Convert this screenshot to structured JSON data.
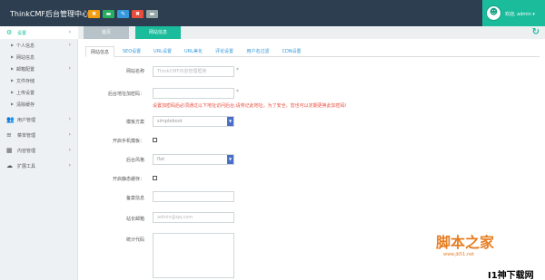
{
  "app": {
    "title": "ThinkCMF后台管理中心"
  },
  "quick_buttons": [
    "✖",
    "▬",
    "✎",
    "✖",
    "▬"
  ],
  "user": {
    "welcome": "欢迎, admin ▾",
    "avatar_glyph": "☻"
  },
  "sidebar": {
    "active_group": {
      "icon": "⚙",
      "label": "设置",
      "chevron": "‹"
    },
    "subitems": [
      {
        "label": "个人信息",
        "chevron": "›"
      },
      {
        "label": "网站信息"
      },
      {
        "label": "邮箱配置",
        "chevron": "›"
      },
      {
        "label": "文件存储"
      },
      {
        "label": "上传设置"
      },
      {
        "label": "清除缓存"
      }
    ],
    "groups": [
      {
        "icon": "👥",
        "label": "用户管理",
        "chevron": "›"
      },
      {
        "icon": "≡",
        "label": "菜单管理",
        "chevron": "›"
      },
      {
        "icon": "▦",
        "label": "内容管理",
        "chevron": "›"
      },
      {
        "icon": "☁",
        "label": "扩展工具",
        "chevron": "›"
      }
    ]
  },
  "page_tabs": [
    "首页",
    "网站信息"
  ],
  "refresh_icon": "↻",
  "settings_tabs": [
    "网站信息",
    "SEO设置",
    "URL设置",
    "URL美化",
    "评论设置",
    "用户名过滤",
    "CDN设置"
  ],
  "form": {
    "site_name": {
      "label": "网站名称",
      "placeholder": "ThinkCMF内容管理框架",
      "required": "*"
    },
    "admin_entry": {
      "label": "后台地址加密码：",
      "required": "*",
      "hint": "设置加密码后必须通过以下地址访问后台,请劳记此地址，为了安全，您也可以定期更换此加密码!"
    },
    "admin_theme": {
      "label": "模板方案",
      "value": "simpleboot"
    },
    "mobile_theme": {
      "label": "开启手机模板："
    },
    "admin_skin": {
      "label": "后台风格",
      "value": "flat"
    },
    "static_cache": {
      "label": "开启静态缓存："
    },
    "icp": {
      "label": "备案信息"
    },
    "admin_email": {
      "label": "站长邮箱",
      "placeholder": "admin@qq.com"
    },
    "analytics": {
      "label": "统计代码"
    }
  },
  "watermarks": {
    "jb51": "脚本之家",
    "jb51_url": "www.jb51.net",
    "downza": "I1神下载网"
  },
  "colors": {
    "topbar": "#2c3e50",
    "accent": "#1abc9c",
    "link": "#3498db",
    "hint": "#e74c3c"
  }
}
